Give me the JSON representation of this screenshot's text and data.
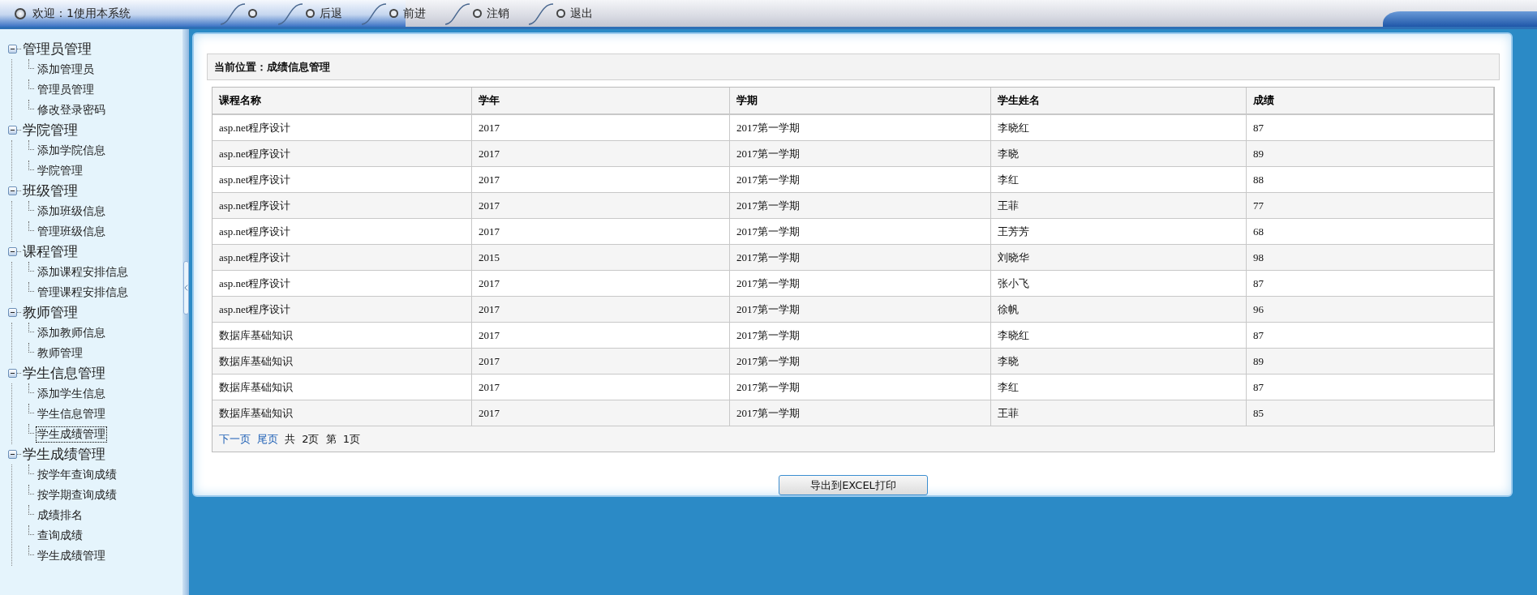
{
  "header": {
    "welcome": "欢迎：1使用本系统",
    "nav": [
      {
        "kind": "icon"
      },
      {
        "kind": "link",
        "label": "后退"
      },
      {
        "kind": "link",
        "label": "前进"
      },
      {
        "kind": "link",
        "label": "注销"
      },
      {
        "kind": "link",
        "label": "退出"
      }
    ]
  },
  "sidebar": {
    "groups": [
      {
        "label": "管理员管理",
        "expanded": true,
        "children": [
          {
            "label": "添加管理员",
            "selected": false
          },
          {
            "label": "管理员管理",
            "selected": false
          },
          {
            "label": "修改登录密码",
            "selected": false
          }
        ]
      },
      {
        "label": "学院管理",
        "expanded": true,
        "children": [
          {
            "label": "添加学院信息",
            "selected": false
          },
          {
            "label": "学院管理",
            "selected": false
          }
        ]
      },
      {
        "label": "班级管理",
        "expanded": true,
        "children": [
          {
            "label": "添加班级信息",
            "selected": false
          },
          {
            "label": "管理班级信息",
            "selected": false
          }
        ]
      },
      {
        "label": "课程管理",
        "expanded": true,
        "children": [
          {
            "label": "添加课程安排信息",
            "selected": false
          },
          {
            "label": "管理课程安排信息",
            "selected": false
          }
        ]
      },
      {
        "label": "教师管理",
        "expanded": true,
        "children": [
          {
            "label": "添加教师信息",
            "selected": false
          },
          {
            "label": "教师管理",
            "selected": false
          }
        ]
      },
      {
        "label": "学生信息管理",
        "expanded": true,
        "children": [
          {
            "label": "添加学生信息",
            "selected": false
          },
          {
            "label": "学生信息管理",
            "selected": false
          },
          {
            "label": "学生成绩管理",
            "selected": true
          }
        ]
      },
      {
        "label": "学生成绩管理",
        "expanded": true,
        "children": [
          {
            "label": "按学年查询成绩",
            "selected": false
          },
          {
            "label": "按学期查询成绩",
            "selected": false
          },
          {
            "label": "成绩排名",
            "selected": false
          },
          {
            "label": "查询成绩",
            "selected": false
          },
          {
            "label": "学生成绩管理",
            "selected": false
          }
        ]
      }
    ]
  },
  "breadcrumb": "当前位置：成绩信息管理",
  "table": {
    "columns": [
      "课程名称",
      "学年",
      "学期",
      "学生姓名",
      "成绩"
    ],
    "rows": [
      [
        "asp.net程序设计",
        "2017",
        "2017第一学期",
        "李晓红",
        "87"
      ],
      [
        "asp.net程序设计",
        "2017",
        "2017第一学期",
        "李晓",
        "89"
      ],
      [
        "asp.net程序设计",
        "2017",
        "2017第一学期",
        "李红",
        "88"
      ],
      [
        "asp.net程序设计",
        "2017",
        "2017第一学期",
        "王菲",
        "77"
      ],
      [
        "asp.net程序设计",
        "2017",
        "2017第一学期",
        "王芳芳",
        "68"
      ],
      [
        "asp.net程序设计",
        "2015",
        "2017第一学期",
        "刘晓华",
        "98"
      ],
      [
        "asp.net程序设计",
        "2017",
        "2017第一学期",
        "张小飞",
        "87"
      ],
      [
        "asp.net程序设计",
        "2017",
        "2017第一学期",
        "徐帆",
        "96"
      ],
      [
        "数据库基础知识",
        "2017",
        "2017第一学期",
        "李晓红",
        "87"
      ],
      [
        "数据库基础知识",
        "2017",
        "2017第一学期",
        "李晓",
        "89"
      ],
      [
        "数据库基础知识",
        "2017",
        "2017第一学期",
        "李红",
        "87"
      ],
      [
        "数据库基础知识",
        "2017",
        "2017第一学期",
        "王菲",
        "85"
      ]
    ]
  },
  "pager": {
    "links": [
      "下一页",
      "尾页"
    ],
    "info": "共 2页 第 1页"
  },
  "export_button": "导出到EXCEL打印"
}
